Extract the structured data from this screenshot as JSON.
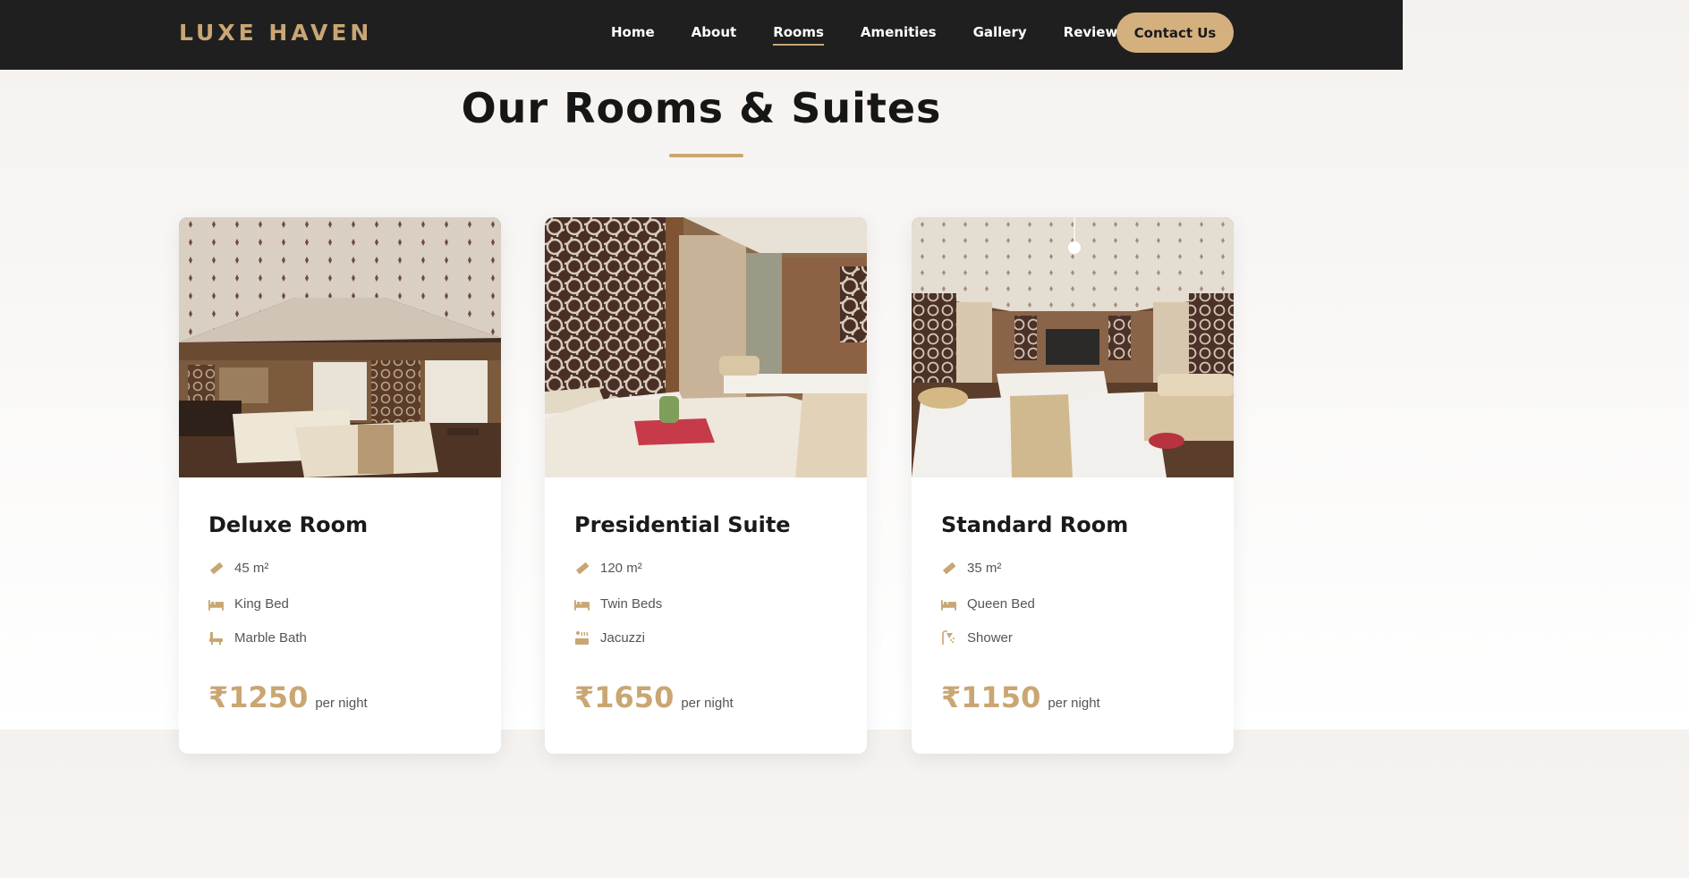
{
  "brand": {
    "logo": "LUXE HAVEN"
  },
  "nav": {
    "items": [
      {
        "label": "Home"
      },
      {
        "label": "About"
      },
      {
        "label": "Rooms",
        "active": true
      },
      {
        "label": "Amenities"
      },
      {
        "label": "Gallery"
      },
      {
        "label": "Reviews"
      }
    ],
    "cta": "Contact Us"
  },
  "section": {
    "title": "Our Rooms & Suites"
  },
  "colors": {
    "accent": "#c9a672",
    "nav_bg": "#1f1f1f",
    "cta_bg": "#d4b07e"
  },
  "rooms": [
    {
      "name": "Deluxe Room",
      "features": [
        {
          "icon": "ruler-icon",
          "text": "45 m²"
        },
        {
          "icon": "bed-icon",
          "text": "King Bed"
        },
        {
          "icon": "bath-icon",
          "text": "Marble Bath"
        }
      ],
      "price": "₹1250",
      "price_unit": "per night"
    },
    {
      "name": "Presidential Suite",
      "features": [
        {
          "icon": "ruler-icon",
          "text": "120 m²"
        },
        {
          "icon": "bed-icon",
          "text": "Twin Beds"
        },
        {
          "icon": "hot-tub-icon",
          "text": "Jacuzzi"
        }
      ],
      "price": "₹1650",
      "price_unit": "per night"
    },
    {
      "name": "Standard Room",
      "features": [
        {
          "icon": "ruler-icon",
          "text": "35 m²"
        },
        {
          "icon": "bed-icon",
          "text": "Queen Bed"
        },
        {
          "icon": "shower-icon",
          "text": "Shower"
        }
      ],
      "price": "₹1150",
      "price_unit": "per night"
    }
  ]
}
